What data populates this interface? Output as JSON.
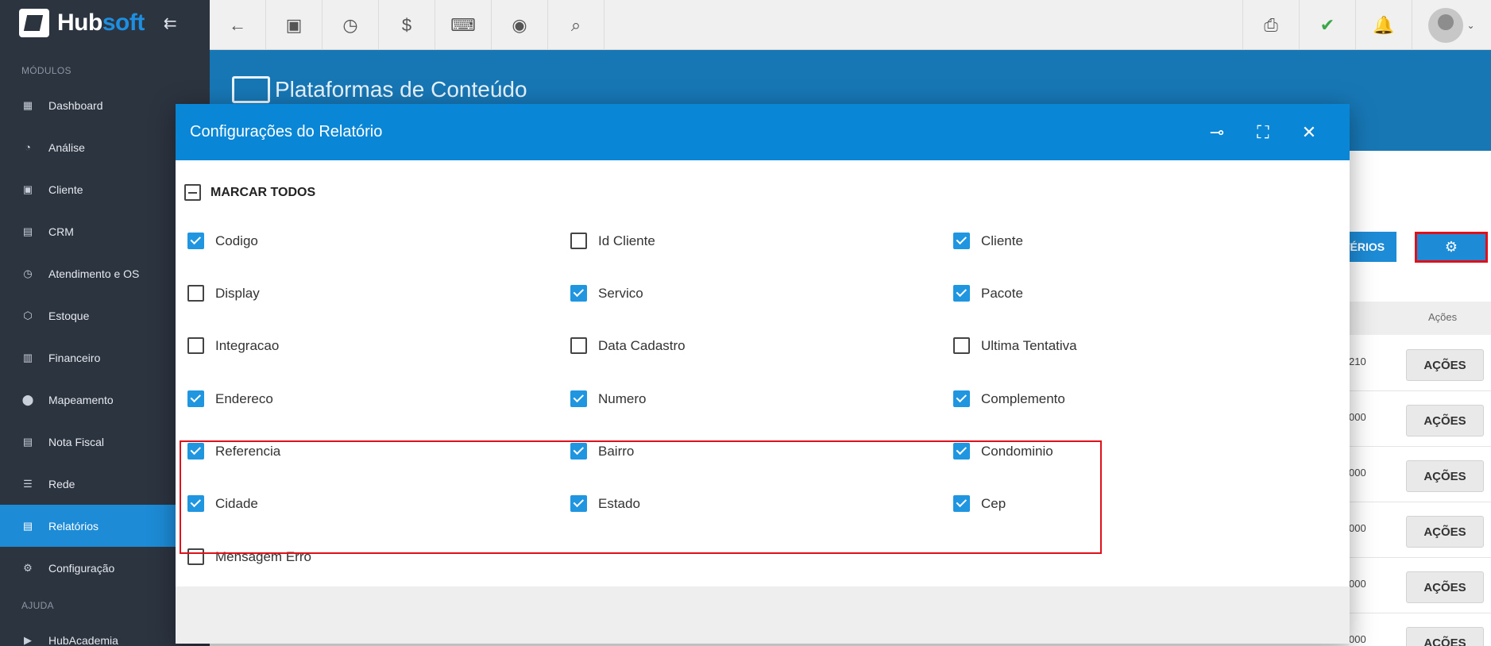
{
  "sidebar": {
    "logo_part1": "Hub",
    "logo_part2": "soft",
    "section_modulos": "MÓDULOS",
    "section_ajuda": "AJUDA",
    "items": [
      {
        "label": "Dashboard",
        "icon": "dashboard-icon"
      },
      {
        "label": "Análise",
        "icon": "pie-chart-icon"
      },
      {
        "label": "Cliente",
        "icon": "contact-card-icon"
      },
      {
        "label": "CRM",
        "icon": "crm-icon"
      },
      {
        "label": "Atendimento e OS",
        "icon": "calendar-clock-icon"
      },
      {
        "label": "Estoque",
        "icon": "box-icon"
      },
      {
        "label": "Financeiro",
        "icon": "money-icon"
      },
      {
        "label": "Mapeamento",
        "icon": "map-pin-icon"
      },
      {
        "label": "Nota Fiscal",
        "icon": "invoice-icon"
      },
      {
        "label": "Rede",
        "icon": "server-icon"
      },
      {
        "label": "Relatórios",
        "icon": "report-icon"
      },
      {
        "label": "Configuração",
        "icon": "gear-icon"
      }
    ],
    "ajuda_items": [
      {
        "label": "HubAcademia",
        "icon": "video-icon"
      }
    ]
  },
  "topbar": {
    "left_icons": [
      "back-arrow-icon",
      "contact-card-icon",
      "calendar-clock-icon",
      "dollar-icon",
      "terminal-icon",
      "eye-icon",
      "search-icon"
    ],
    "right_icons": [
      "pdf-icon",
      "chat-check-icon",
      "bell-icon"
    ]
  },
  "page": {
    "title": "Plataformas de Conteúdo",
    "criterios_button": "TÉRIOS",
    "acoes_header": "Ações",
    "row_numbers": [
      "210",
      "000",
      "000",
      "000",
      "000",
      "000"
    ],
    "acoes_button": "AÇÕES"
  },
  "dialog": {
    "title": "Configurações do Relatório",
    "marcar_todos": "MARCAR TODOS",
    "fields": [
      {
        "label": "Codigo",
        "checked": true
      },
      {
        "label": "Id Cliente",
        "checked": false
      },
      {
        "label": "Cliente",
        "checked": true
      },
      {
        "label": "Display",
        "checked": false
      },
      {
        "label": "Servico",
        "checked": true
      },
      {
        "label": "Pacote",
        "checked": true
      },
      {
        "label": "Integracao",
        "checked": false
      },
      {
        "label": "Data Cadastro",
        "checked": false
      },
      {
        "label": "Ultima Tentativa",
        "checked": false
      },
      {
        "label": "Endereco",
        "checked": true
      },
      {
        "label": "Numero",
        "checked": true
      },
      {
        "label": "Complemento",
        "checked": true
      },
      {
        "label": "Referencia",
        "checked": true
      },
      {
        "label": "Bairro",
        "checked": true
      },
      {
        "label": "Condominio",
        "checked": true
      },
      {
        "label": "Cidade",
        "checked": true
      },
      {
        "label": "Estado",
        "checked": true
      },
      {
        "label": "Cep",
        "checked": true
      },
      {
        "label": "Mensagem Erro",
        "checked": false
      }
    ]
  },
  "colors": {
    "sidebar_bg": "#2c3440",
    "accent": "#1d8bd6",
    "dialog_header": "#0a86d6",
    "highlight": "#e0101a"
  }
}
